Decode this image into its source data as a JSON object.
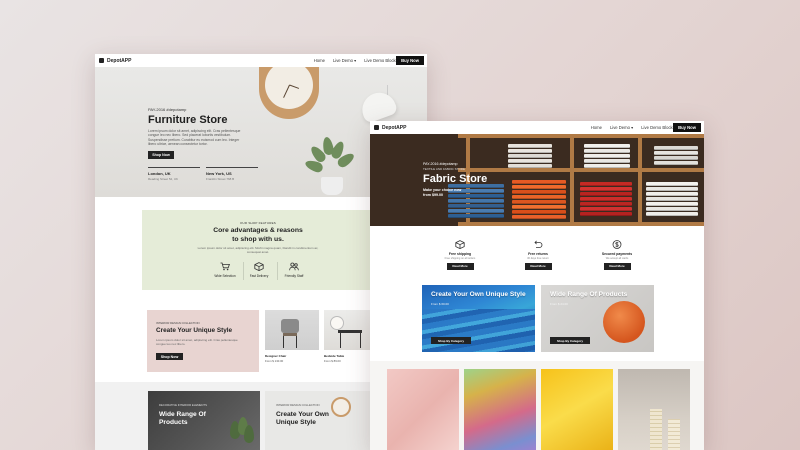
{
  "left": {
    "nav": {
      "brand": "DepotAPP",
      "links": [
        "Home",
        "Live Demo ▾",
        "Live Demo Blocks ▾"
      ],
      "buy_label": "Buy Now"
    },
    "hero": {
      "tag": "PAY-2016  #depotamp",
      "title": "Furniture Store",
      "desc": "Lorem ipsum dolor sit amet, adipiscing elit. Cras pellentesque congue leo nec libero. Sed placerat lobortis vestibulum. Suspendisse pretium. Curabitur eu euismod cum leo. Integer libero ultrice, aenean consectetur tortor.",
      "shop_label": "Shop Now",
      "locations": [
        {
          "city": "London, UK",
          "address": "Reading Street 52, UK"
        },
        {
          "city": "New York, US",
          "address": "Franklin Street 768 B"
        }
      ]
    },
    "features": {
      "eyebrow": "OUR SHOP FEATURES",
      "title_line1": "Core advantages & reasons",
      "title_line2": "to shop with us.",
      "desc": "Lorem ipsum dolor sit amet, adipiscing elit. Morbi magna quam, blandit in condimentum ac, consequat amet.",
      "items": [
        {
          "label": "Wide Selection",
          "icon": "cart-icon"
        },
        {
          "label": "Fast Delivery",
          "icon": "box-icon"
        },
        {
          "label": "Friendly Staff",
          "icon": "people-icon"
        }
      ]
    },
    "collection": {
      "eyebrow": "INTERIOR DESIGN COLLECTION",
      "title": "Create Your Unique Style",
      "desc": "Lorem ipsum dolor sit amet, adipiscing elit. Cras pellentesque congue leo nec libero.",
      "shop_label": "Shop Now"
    },
    "products": [
      {
        "name": "Designer Chair",
        "price": "From $ 130.00"
      },
      {
        "name": "Bedside Table",
        "price": "From $ 89.00"
      }
    ],
    "promos": [
      {
        "eyebrow": "DECORATIVE INTERIOR ELEMENTS",
        "title": "Wide Range Of Products"
      },
      {
        "eyebrow": "INTERIOR DESIGN COLLECTION",
        "title": "Create Your Own Unique Style"
      }
    ]
  },
  "right": {
    "nav": {
      "brand": "DepotAPP",
      "links": [
        "Home",
        "Live Demo ▾",
        "Live Demo Blocks ▾"
      ],
      "buy_label": "Buy Now"
    },
    "hero": {
      "tag": "PAY-2016  #depotamp",
      "tag2": "TEXTILE AND FABRIC STORE",
      "title": "Fabric Store",
      "cta": "Make your choice now from $99.00"
    },
    "benefits": [
      {
        "label": "Free shipping",
        "sub": "Free shipping on all orders",
        "icon": "box-icon",
        "button": "Read More"
      },
      {
        "label": "Free returns",
        "sub": "30 days free return",
        "icon": "return-icon",
        "button": "Read More"
      },
      {
        "label": "Secured payments",
        "sub": "We accept all cards",
        "icon": "dollar-icon",
        "button": "Read More"
      }
    ],
    "tiles": [
      {
        "title": "Create Your Own Unique Style",
        "price": "From $ 60.00",
        "button": "Shop By Category"
      },
      {
        "title": "Wide Range Of Products",
        "price": "From $ 24.00",
        "button": "Shop By Category"
      }
    ]
  },
  "colors": {
    "dark": "#222222",
    "hero_left_bg": "#e4e2de",
    "features_bg": "#e5ecd8",
    "collection_bg": "#e8d4d1"
  }
}
